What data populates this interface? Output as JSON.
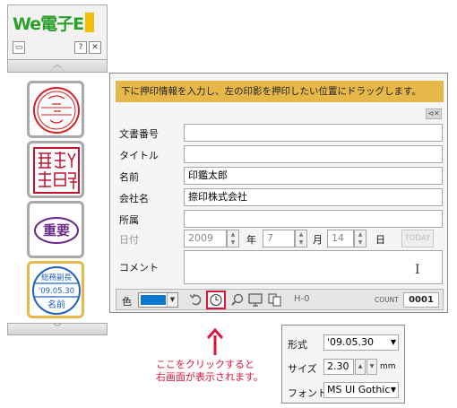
{
  "app": {
    "logo_text": "We電子E",
    "window_buttons": [
      "restore",
      "help",
      "close"
    ]
  },
  "palette": {
    "stamps": [
      {
        "name": "date-stamp-round",
        "color": "#d42020"
      },
      {
        "name": "name-seal-square",
        "color": "#c41230"
      },
      {
        "name": "juuyou-oval",
        "color": "#6a2a8a",
        "text": "重要"
      },
      {
        "name": "approval-date-stamp",
        "color": "#2060c0",
        "top": "総務副長",
        "date": "'09.05.30",
        "bottom": "名前"
      }
    ]
  },
  "dialog": {
    "hint": "下に押印情報を入力し、左の印影を押印したい位置にドラッグします。",
    "fields": [
      {
        "label": "文書番号",
        "value": ""
      },
      {
        "label": "タイトル",
        "value": ""
      },
      {
        "label": "名前",
        "value": "印鑑太郎"
      },
      {
        "label": "会社名",
        "value": "捺印株式会社"
      },
      {
        "label": "所属",
        "value": ""
      }
    ],
    "date": {
      "label": "日付",
      "year": "2009",
      "year_unit": "年",
      "month": "7",
      "month_unit": "月",
      "day": "14",
      "day_unit": "日",
      "today_label": "TODAY"
    },
    "comment_label": "コメント",
    "comment_value": ""
  },
  "toolbar": {
    "color_label": "色",
    "color_value": "#0a78d0",
    "h_label": "H-0",
    "count_label": "COUNT",
    "count_value": "0001",
    "tools": [
      "undo-icon",
      "clock-icon",
      "zoom-icon",
      "monitor-icon",
      "copy-icon"
    ]
  },
  "annotation": {
    "line1": "ここをクリックすると",
    "line2": "右画面が表示されます。",
    "color": "#d8153a"
  },
  "subpanel": {
    "format_label": "形式",
    "format_value": "'09.05.30",
    "size_label": "サイズ",
    "size_value": "2.30",
    "size_unit": "mm",
    "font_label": "フォント",
    "font_value": "MS UI Gothic"
  }
}
